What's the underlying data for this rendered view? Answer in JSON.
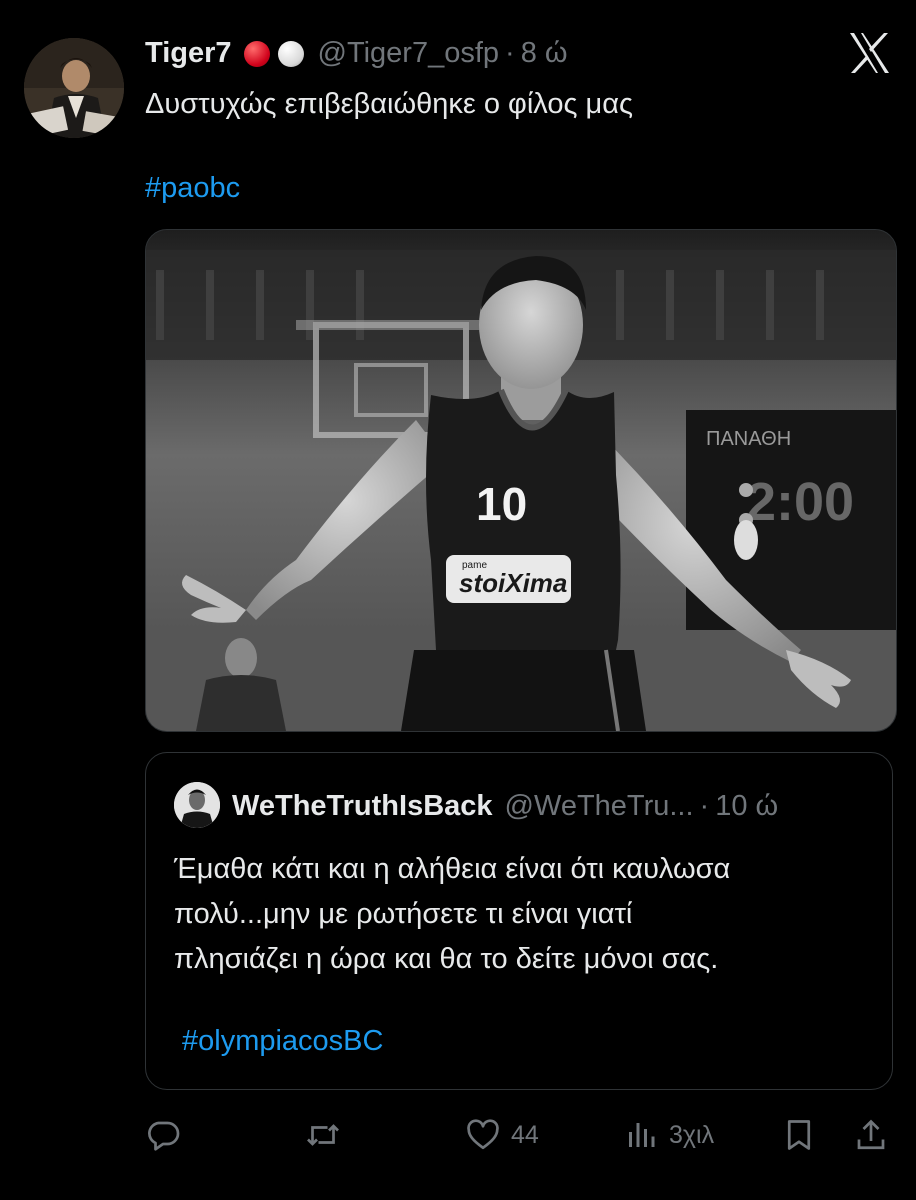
{
  "tweet": {
    "author_name": "Tiger7",
    "handle": "@Tiger7_osfp",
    "separator": "·",
    "age": "8 ώ",
    "text": "Δυστυχώς επιβεβαιώθηκε ο φίλος μας",
    "hashtag": "#paobc",
    "status_emojis": [
      "red-circle",
      "white-circle"
    ]
  },
  "media": {
    "jersey_number": "10",
    "sponsor_text": "stoiXima",
    "sponsor_small": "pame"
  },
  "quoted_tweet": {
    "author_name": "WeTheTruthIsBack",
    "handle": "@WeTheTru...",
    "separator": "·",
    "age": "10 ώ",
    "lines": [
      "Έμαθα κάτι και η αλήθεια είναι ότι καυλωσα",
      "πολύ...μην με ρωτήσετε τι είναι γιατί",
      "πλησιάζει η ώρα και θα το δείτε μόνοι σας."
    ],
    "hashtag": "#olympiacosBC"
  },
  "actions": {
    "reply_icon": "reply-icon",
    "retweet_icon": "retweet-icon",
    "like_icon": "heart-icon",
    "likes_count": "44",
    "views_icon": "views-icon",
    "views_count": "3χιλ",
    "bookmark_icon": "bookmark-icon",
    "share_icon": "share-icon"
  },
  "colors": {
    "background": "#000000",
    "text": "#e7e9ea",
    "muted": "#71767b",
    "link": "#1d9bf0",
    "border": "#2f3336"
  }
}
